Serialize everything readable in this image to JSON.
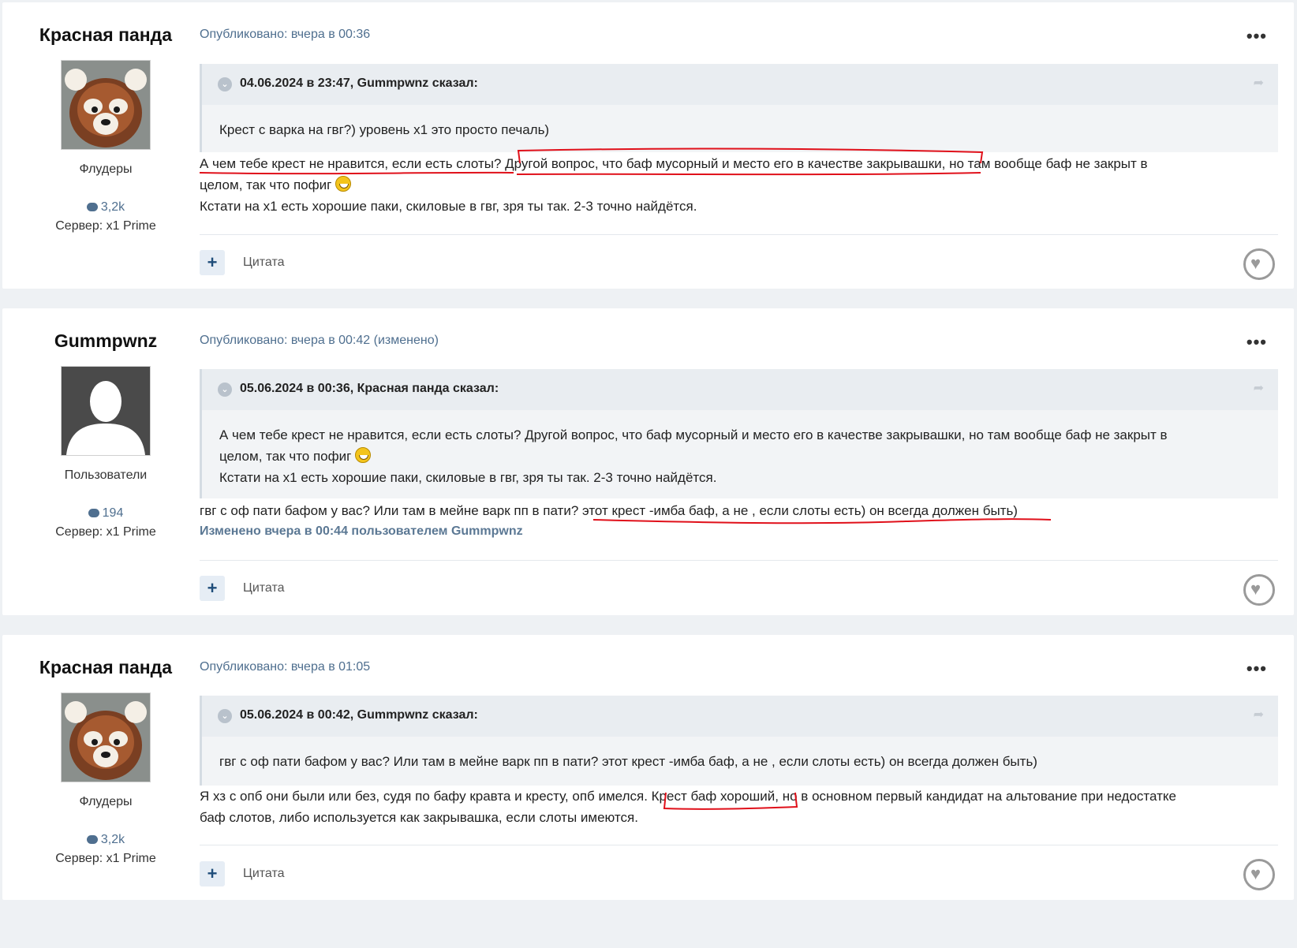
{
  "posts": [
    {
      "author": "Красная панда",
      "group": "Флудеры",
      "post_count": "3,2k",
      "server": "Сервер: x1 Prime",
      "published": "Опубликовано: вчера в 00:36",
      "quote_title": "04.06.2024 в 23:47, Gummpwnz сказал:",
      "quote_text": "Крест с варка на гвг?) уровень x1 это просто печаль)",
      "body_line1_a": "А чем тебе крест не нравится, если есть слоты? ",
      "body_line1_b": "Другой вопрос, что баф мусорный и место его в качестве закрывашки",
      "body_line1_c": ", но там вообще баф не закрыт в",
      "body_line2": "целом, так что пофиг ",
      "body_line3": "Кстати на x1 есть хорошие паки, скиловые в гвг, зря ты так. 2-3 точно найдётся.",
      "quote_button": "Цитата",
      "plus": "+"
    },
    {
      "author": "Gummpwnz",
      "group": "Пользователи",
      "post_count": "194",
      "server": "Сервер: x1 Prime",
      "published": "Опубликовано: вчера в 00:42 (изменено)",
      "quote_title": "05.06.2024 в 00:36, Красная панда сказал:",
      "quote_line1": "А чем тебе крест не нравится, если есть слоты? Другой вопрос, что баф мусорный и место его в качестве закрывашки, но там вообще баф не закрыт в",
      "quote_line2": "целом, так что пофиг ",
      "quote_line3": "Кстати на x1 есть хорошие паки, скиловые в гвг, зря ты так. 2-3 точно найдётся.",
      "body_a": "гвг с оф пати бафом у вас? Или там в мейне варк пп в пати?  ",
      "body_b": "этот крест  -имба баф, а не , если слоты есть) он всегда должен быть)",
      "edited": "Изменено вчера в 00:44 пользователем Gummpwnz",
      "quote_button": "Цитата",
      "plus": "+"
    },
    {
      "author": "Красная панда",
      "group": "Флудеры",
      "post_count": "3,2k",
      "server": "Сервер: x1 Prime",
      "published": "Опубликовано: вчера в 01:05",
      "quote_title": "05.06.2024 в 00:42, Gummpwnz сказал:",
      "quote_text": "гвг с оф пати бафом у вас? Или там в мейне варк пп в пати?  этот крест  -имба баф, а не , если слоты есть) он всегда должен быть)",
      "body_line1_a": "Я хз с опб они были или без, судя по бафу кравта и кресту, опб имелся. ",
      "body_line1_b": "Крест баф хороший",
      "body_line1_c": ", но в основном первый кандидат на альтование при недостатке",
      "body_line2": "баф слотов, либо используется как закрывашка, если слоты имеются.",
      "quote_button": "Цитата",
      "plus": "+"
    }
  ],
  "icons": {
    "menu": "more-dots-icon",
    "chevron": "chevron-circle-icon",
    "share": "share-arrow-icon",
    "like": "heart-icon",
    "comments": "comment-bubble-icon"
  },
  "colors": {
    "accent_text": "#4f6f8f",
    "annotation_red": "#e0101a",
    "quote_bg": "#f2f4f6"
  }
}
